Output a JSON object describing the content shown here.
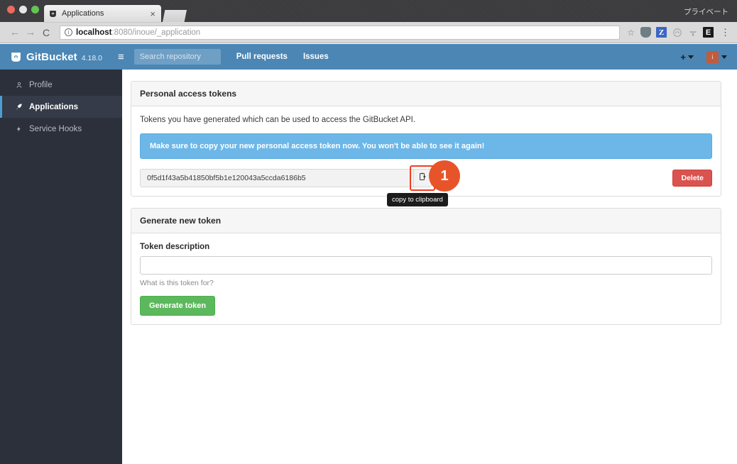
{
  "browser": {
    "tab_title": "Applications",
    "tab_favicon": "gitbucket-icon",
    "close_label": "×",
    "private_label": "プライベート",
    "back_label": "←",
    "forward_label": "→",
    "reload_label": "C",
    "url_prefix": "localhost",
    "url_rest": ":8080/inoue/_application",
    "star_label": "☆",
    "zotero_label": "Z",
    "evernote_label": "E",
    "menu_label": "⋮"
  },
  "gitbucket": {
    "brand": "GitBucket",
    "version": "4.18.0",
    "menu_icon": "≡",
    "search_placeholder": "Search repository",
    "search_value": "",
    "nav_links": [
      {
        "label": "Pull requests"
      },
      {
        "label": "Issues"
      }
    ],
    "plus_label": "+",
    "avatar_initial": "i"
  },
  "sidebar": {
    "items": [
      {
        "label": "Profile",
        "icon": "person-icon",
        "glyph": "⚇",
        "active": false
      },
      {
        "label": "Applications",
        "icon": "rocket-icon",
        "glyph": "➤",
        "active": true
      },
      {
        "label": "Service Hooks",
        "icon": "bolt-icon",
        "glyph": "⚡",
        "active": false
      }
    ]
  },
  "tokens_panel": {
    "title": "Personal access tokens",
    "description": "Tokens you have generated which can be used to access the GitBucket API.",
    "alert": "Make sure to copy your new personal access token now. You won't be able to see it again!",
    "token_value": "0f5d1f43a5b41850bf5b1e120043a5ccda6186b5",
    "copy_icon": "clipboard-icon",
    "tooltip": "copy to clipboard",
    "annotation_badge": "1",
    "delete_label": "Delete"
  },
  "generate_panel": {
    "title": "Generate new token",
    "field_label": "Token description",
    "input_value": "",
    "input_placeholder": "",
    "help_text": "What is this token for?",
    "button_label": "Generate token"
  },
  "colors": {
    "header_blue": "#4b86b4",
    "sidebar_dark": "#2b303b",
    "active_accent": "#4b9fd5",
    "alert_blue": "#6cb7e8",
    "delete_red": "#d9534f",
    "generate_green": "#5cb85c",
    "annotation_orange": "#e8542a",
    "highlight_red": "#ef3e23"
  }
}
